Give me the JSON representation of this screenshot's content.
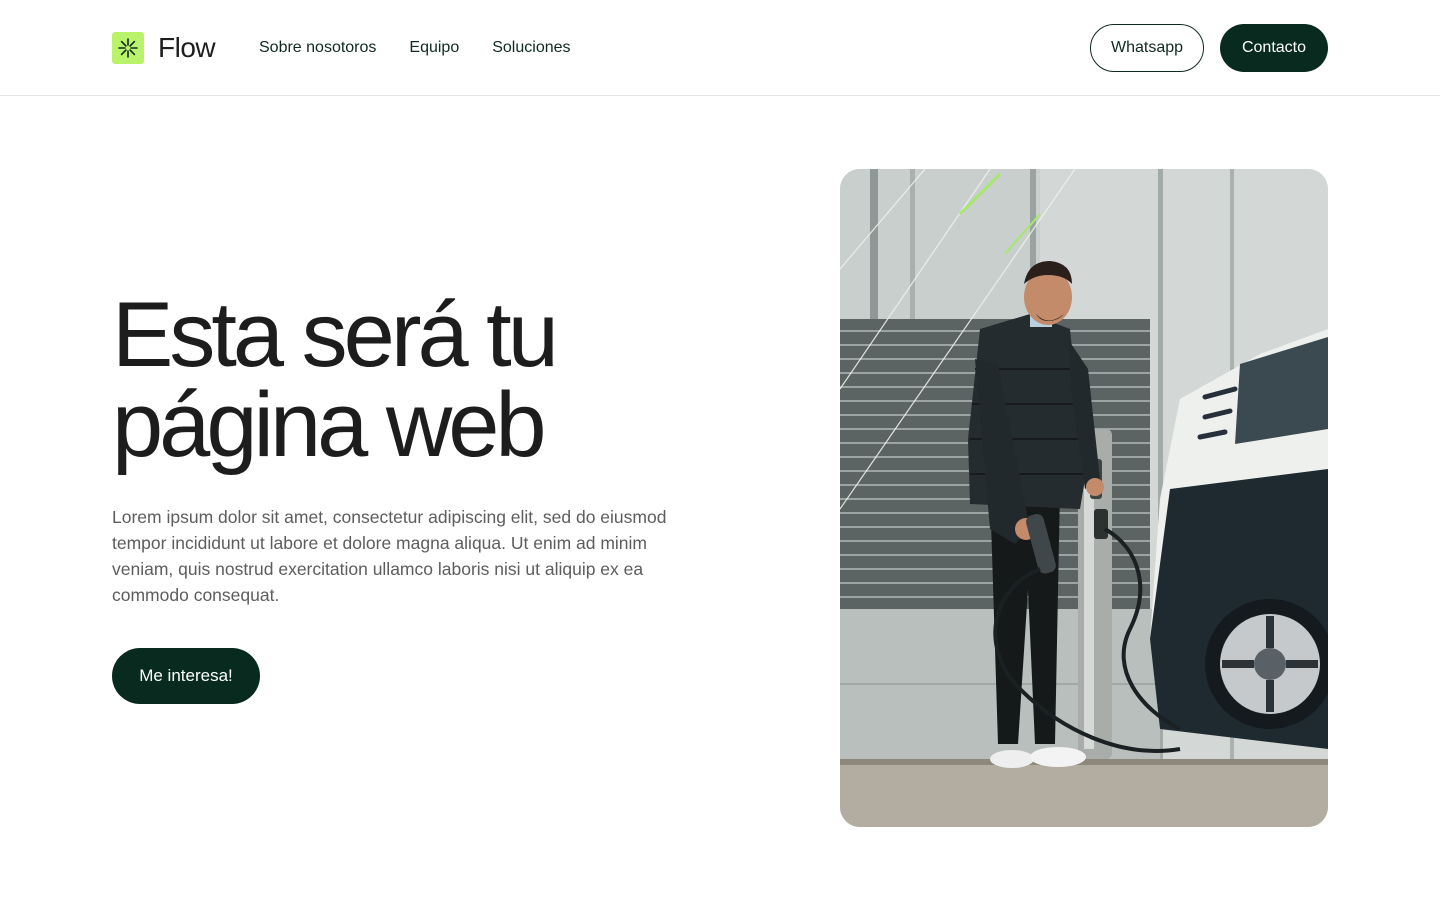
{
  "brand": {
    "name": "Flow",
    "logo_icon": "asterisk-icon",
    "accent_color": "#b9f26b",
    "dark_color": "#082a1f"
  },
  "nav": {
    "items": [
      {
        "label": "Sobre nosotoros"
      },
      {
        "label": "Equipo"
      },
      {
        "label": "Soluciones"
      }
    ]
  },
  "header_actions": {
    "whatsapp_label": "Whatsapp",
    "contact_label": "Contacto"
  },
  "hero": {
    "title_line1": "Esta será tu",
    "title_line2": "página web",
    "description": "Lorem ipsum dolor sit amet, consectetur adipiscing elit, sed do eiusmod tempor incididunt ut labore et dolore magna aliqua. Ut enim ad minim veniam, quis nostrud exercitation ullamco laboris nisi ut aliquip ex ea commodo consequat.",
    "cta_label": "Me interesa!"
  }
}
